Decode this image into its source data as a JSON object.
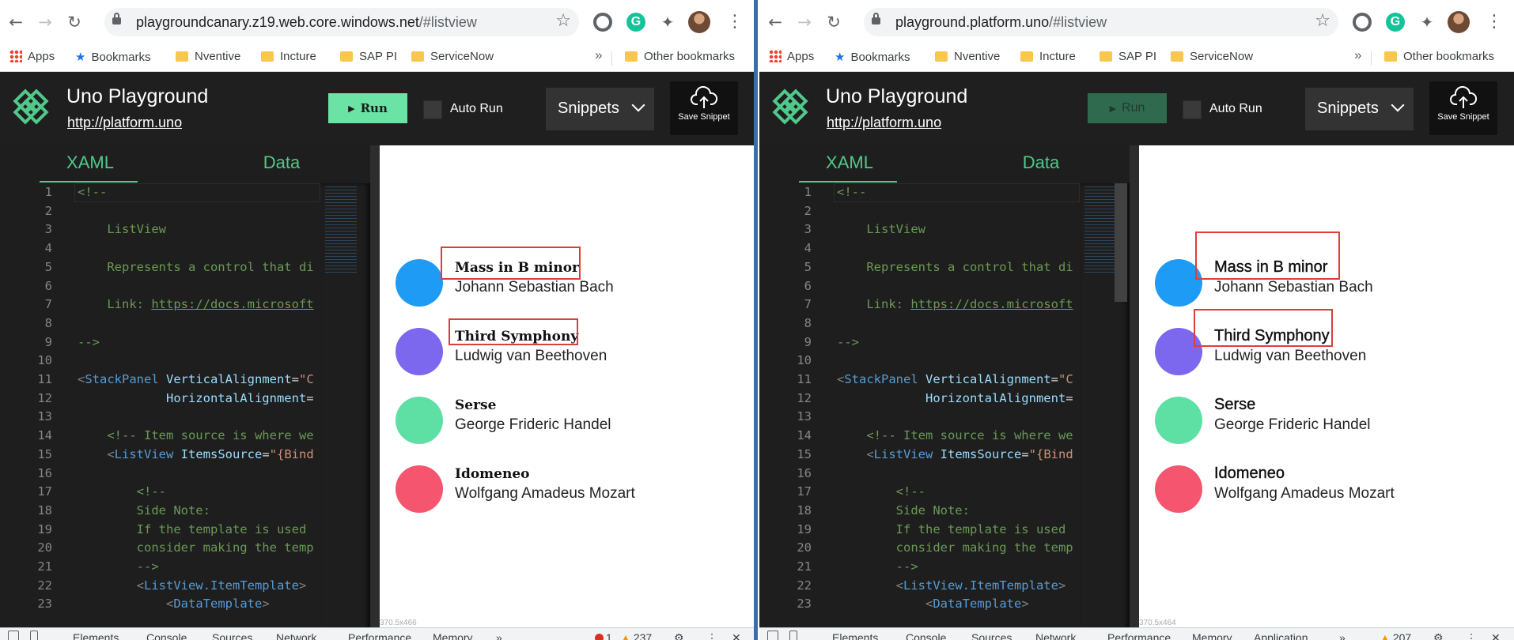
{
  "panes": [
    {
      "id": "left",
      "url_host": "playgroundcanary.z19.web.core.windows.net",
      "url_path": "/#listview",
      "run_label": "Run",
      "preview_size": "370.5x466",
      "error_count": "1",
      "warning_count": "237"
    },
    {
      "id": "right",
      "url_host": "playground.platform.uno",
      "url_path": "/#listview",
      "run_label": "Run",
      "preview_size": "370.5x464",
      "error_count": "",
      "warning_count": "207"
    }
  ],
  "bookmarks": {
    "apps": "Apps",
    "items": [
      "Bookmarks",
      "Nventive",
      "Incture",
      "SAP PI",
      "ServiceNow"
    ],
    "overflow": "»",
    "other": "Other bookmarks"
  },
  "header": {
    "title": "Uno Playground",
    "link": "http://platform.uno",
    "auto_run_label": "Auto Run",
    "snippets_label": "Snippets",
    "save_label": "Save Snippet"
  },
  "editor": {
    "tabs": [
      "XAML",
      "Data"
    ],
    "line_numbers": [
      "1",
      "2",
      "3",
      "4",
      "5",
      "6",
      "7",
      "8",
      "9",
      "10",
      "11",
      "12",
      "13",
      "14",
      "15",
      "16",
      "17",
      "18",
      "19",
      "20",
      "21",
      "22",
      "23"
    ],
    "lines": [
      [
        {
          "c": "c-com",
          "t": "<!--"
        }
      ],
      [],
      [
        {
          "c": "c-com",
          "t": "    ListView"
        }
      ],
      [],
      [
        {
          "c": "c-com",
          "t": "    Represents a control that di"
        }
      ],
      [],
      [
        {
          "c": "c-com",
          "t": "    Link: "
        },
        {
          "c": "c-link",
          "t": "https://docs.microsoft"
        }
      ],
      [],
      [
        {
          "c": "c-com",
          "t": "-->"
        }
      ],
      [],
      [
        {
          "c": "c-punc",
          "t": "<"
        },
        {
          "c": "c-tag",
          "t": "StackPanel"
        },
        {
          "c": "c-plain",
          "t": " "
        },
        {
          "c": "c-attr",
          "t": "VerticalAlignment"
        },
        {
          "c": "c-plain",
          "t": "="
        },
        {
          "c": "c-str",
          "t": "\"C"
        }
      ],
      [
        {
          "c": "c-plain",
          "t": "            "
        },
        {
          "c": "c-attr",
          "t": "HorizontalAlignment"
        },
        {
          "c": "c-plain",
          "t": "="
        }
      ],
      [],
      [
        {
          "c": "c-com",
          "t": "    <!-- Item source is where we"
        }
      ],
      [
        {
          "c": "c-plain",
          "t": "    "
        },
        {
          "c": "c-punc",
          "t": "<"
        },
        {
          "c": "c-tag",
          "t": "ListView"
        },
        {
          "c": "c-plain",
          "t": " "
        },
        {
          "c": "c-attr",
          "t": "ItemsSource"
        },
        {
          "c": "c-plain",
          "t": "="
        },
        {
          "c": "c-str",
          "t": "\"{Bind"
        }
      ],
      [],
      [
        {
          "c": "c-com",
          "t": "        <!--"
        }
      ],
      [
        {
          "c": "c-com",
          "t": "        Side Note:"
        }
      ],
      [
        {
          "c": "c-com",
          "t": "        If the template is used"
        }
      ],
      [
        {
          "c": "c-com",
          "t": "        consider making the temp"
        }
      ],
      [
        {
          "c": "c-com",
          "t": "        -->"
        }
      ],
      [
        {
          "c": "c-plain",
          "t": "        "
        },
        {
          "c": "c-punc",
          "t": "<"
        },
        {
          "c": "c-tag",
          "t": "ListView.ItemTemplate"
        },
        {
          "c": "c-punc",
          "t": ">"
        }
      ],
      [
        {
          "c": "c-plain",
          "t": "            "
        },
        {
          "c": "c-punc",
          "t": "<"
        },
        {
          "c": "c-tag",
          "t": "DataTemplate"
        },
        {
          "c": "c-punc",
          "t": ">"
        }
      ]
    ]
  },
  "list_items": [
    {
      "title": "Mass in B minor",
      "subtitle": "Johann Sebastian Bach",
      "color": "#1e9bf5"
    },
    {
      "title": "Third Symphony",
      "subtitle": "Ludwig van Beethoven",
      "color": "#7b68ee"
    },
    {
      "title": "Serse",
      "subtitle": "George Frideric Handel",
      "color": "#5ee0a4"
    },
    {
      "title": "Idomeneo",
      "subtitle": "Wolfgang Amadeus Mozart",
      "color": "#f5556f"
    }
  ],
  "devtools": {
    "tabs_left": [
      "Elements",
      "Console",
      "Sources",
      "Network",
      "Performance",
      "Memory"
    ],
    "tabs_right": [
      "Elements",
      "Console",
      "Sources",
      "Network",
      "Performance",
      "Memory",
      "Application"
    ],
    "overflow": "»"
  },
  "colors": {
    "accent": "#50c98b",
    "run_button": "#6be3a5",
    "annotation": "#e03c3c"
  }
}
